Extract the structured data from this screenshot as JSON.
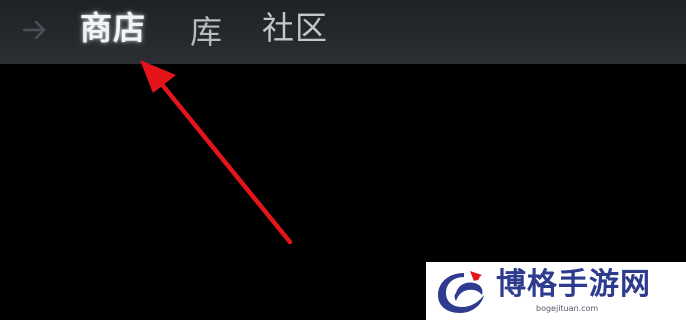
{
  "navbar": {
    "back_icon": "arrow-right-icon",
    "tabs": [
      {
        "label": "商店",
        "active": true
      },
      {
        "label": "库",
        "active": false
      },
      {
        "label": "社区",
        "active": false
      }
    ]
  },
  "annotation": {
    "icon": "red-pointer-arrow",
    "color": "#e4141b"
  },
  "watermark": {
    "title": "博格手游网",
    "url": "bogejituan.com",
    "brand_color": "#2f3b8f",
    "accent_color": "#e4141b"
  },
  "colors": {
    "background": "#000000",
    "navbar": "#25292d",
    "active_tab_text": "#f2f4f6",
    "inactive_tab_text": "#b7bcc1"
  }
}
